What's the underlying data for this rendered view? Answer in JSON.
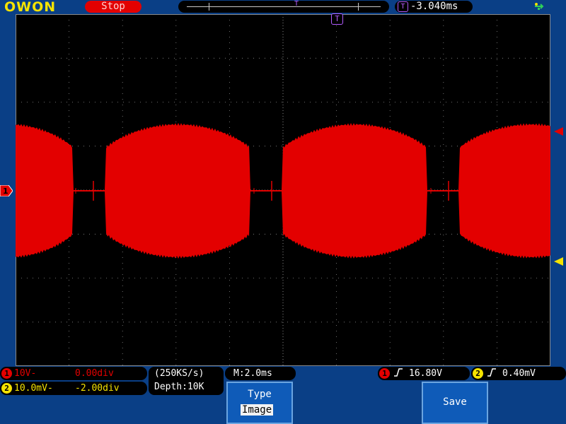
{
  "header": {
    "brand": "OWON",
    "run_status": "Stop",
    "trigger_position_icon": "T",
    "trigger_position": "-3.040ms",
    "usb_icon": "usb-icon"
  },
  "markers": {
    "ch1_offset": "1",
    "trigger_time_marker": "T"
  },
  "channels": [
    {
      "badge": "1",
      "volts_div": "10V-",
      "offset": "0.00div",
      "color": "#e30000"
    },
    {
      "badge": "2",
      "volts_div": "10.0mV-",
      "offset": "-2.00div",
      "color": "#f5e300"
    }
  ],
  "acquisition": {
    "sample_rate": "(250KS/s)",
    "depth": "Depth:10K",
    "timebase": "M:2.0ms"
  },
  "trigger": {
    "ch1_badge": "1",
    "ch1_level": "16.80V",
    "ch2_badge": "2",
    "ch2_level": "0.40mV"
  },
  "softkeys": {
    "type_label": "Type",
    "type_value": "Image",
    "save_label": "Save"
  },
  "colors": {
    "background": "#0a3f86",
    "screen": "#000000",
    "trace_ch1": "#e30000",
    "trigger_purple": "#b35cff"
  }
}
